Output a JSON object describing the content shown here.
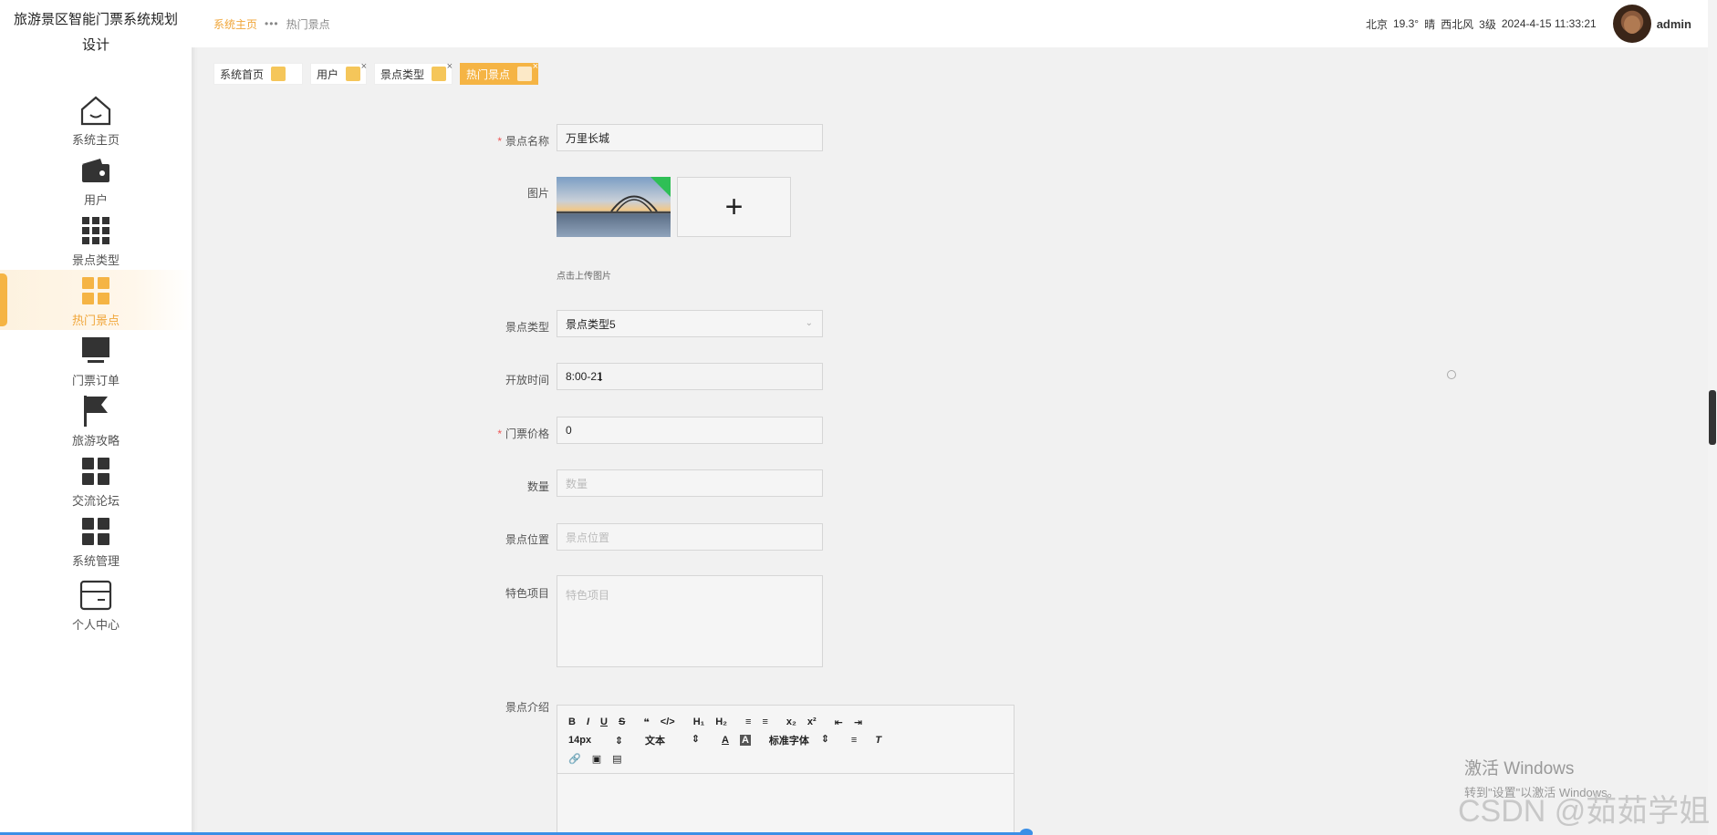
{
  "app": {
    "title": "旅游景区智能门票系统规划设计"
  },
  "sidebar": {
    "items": [
      {
        "label": "系统主页",
        "icon": "house-icon"
      },
      {
        "label": "用户",
        "icon": "wallet-icon"
      },
      {
        "label": "景点类型",
        "icon": "grid-icon"
      },
      {
        "label": "热门景点",
        "icon": "grid-four-icon"
      },
      {
        "label": "门票订单",
        "icon": "monitor-icon"
      },
      {
        "label": "旅游攻略",
        "icon": "flag-icon"
      },
      {
        "label": "交流论坛",
        "icon": "grid-four-icon"
      },
      {
        "label": "系统管理",
        "icon": "grid-four-icon"
      },
      {
        "label": "个人中心",
        "icon": "card-icon"
      }
    ],
    "active_index": 3
  },
  "header": {
    "breadcrumb_home": "系统主页",
    "breadcrumb_sep": "•••",
    "breadcrumb_current": "热门景点",
    "city": "北京",
    "temp": "19.3°",
    "weather": "晴",
    "wind_dir": "西北风",
    "wind_level": "3级",
    "datetime": "2024-4-15 11:33:21",
    "username": "admin"
  },
  "tabs": [
    {
      "label": "系统首页",
      "closable": false
    },
    {
      "label": "用户",
      "closable": true
    },
    {
      "label": "景点类型",
      "closable": true
    },
    {
      "label": "热门景点",
      "closable": true,
      "active": true
    }
  ],
  "form": {
    "name_label": "景点名称",
    "name_value": "万里长城",
    "image_label": "图片",
    "upload_plus": "+",
    "upload_tip": "点击上传图片",
    "type_label": "景点类型",
    "type_value": "景点类型5",
    "open_time_label": "开放时间",
    "open_time_value": "8:00-21",
    "price_label": "门票价格",
    "price_value": "0",
    "qty_label": "数量",
    "qty_placeholder": "数量",
    "location_label": "景点位置",
    "location_placeholder": "景点位置",
    "feature_label": "特色项目",
    "feature_placeholder": "特色项目",
    "intro_label": "景点介绍"
  },
  "editor": {
    "font_size": "14px",
    "text_style": "文本",
    "font_family": "标准字体"
  },
  "watermark": {
    "line1": "激活 Windows",
    "line2": "转到\"设置\"以激活 Windows。",
    "csdn": "CSDN @茹茹学姐"
  },
  "colors": {
    "accent": "#f5b444",
    "required": "#e55555"
  }
}
